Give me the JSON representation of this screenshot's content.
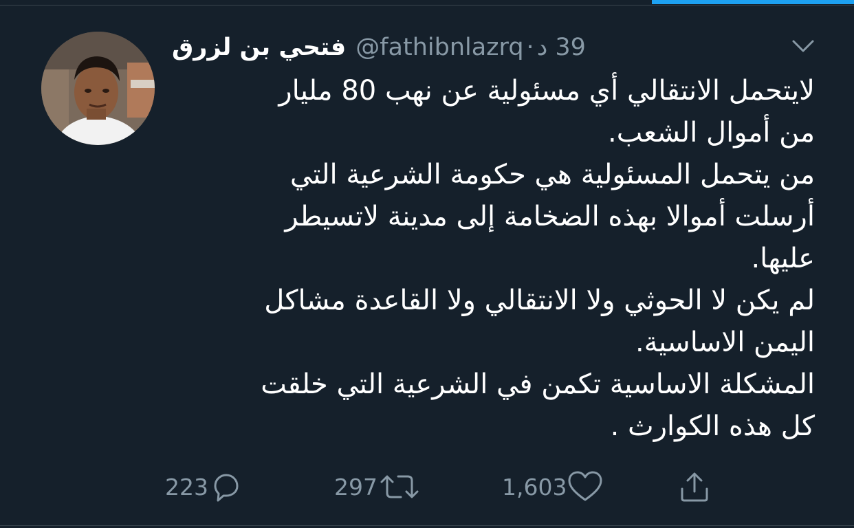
{
  "tweet": {
    "display_name": "فتحي بن لزرق",
    "handle": "@fathibnlazrq",
    "separator": "·",
    "timestamp": "39 د",
    "lines": [
      "لايتحمل الانتقالي أي مسئولية عن نهب 80 مليار",
      "من أموال الشعب.",
      "من يتحمل المسئولية هي حكومة الشرعية التي",
      "أرسلت أموالا بهذه الضخامة إلى مدينة لاتسيطر",
      "عليها.",
      "لم يكن لا الحوثي ولا الانتقالي ولا القاعدة مشاكل",
      "اليمن الاساسية.",
      "المشكلة الاساسية تكمن في الشرعية التي خلقت",
      "كل هذه الكوارث ."
    ]
  },
  "actions": {
    "reply": {
      "count": "223",
      "icon": "reply-icon"
    },
    "retweet": {
      "count": "297",
      "icon": "retweet-icon"
    },
    "like": {
      "count": "1,603",
      "icon": "heart-icon"
    },
    "share": {
      "icon": "share-icon"
    }
  },
  "colors": {
    "background": "#15202b",
    "text": "#ffffff",
    "secondary": "#8899a6",
    "accent": "#1da1f2",
    "divider": "#38444d"
  }
}
